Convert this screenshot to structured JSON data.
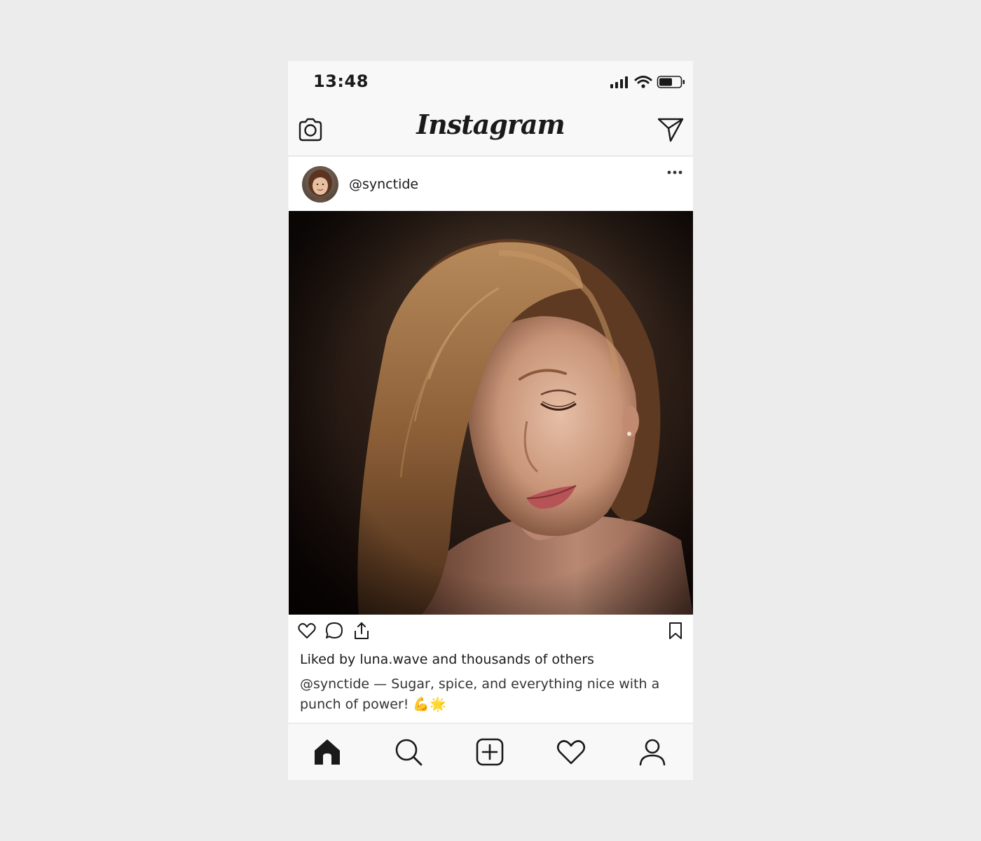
{
  "status_bar": {
    "time": "13:48",
    "icons": [
      "signal-icon",
      "wifi-icon",
      "battery-icon"
    ]
  },
  "header": {
    "logo": "Instagram",
    "left_icon": "camera-icon",
    "right_icon": "send-icon"
  },
  "post": {
    "username": "@synctide",
    "more_icon": "more-dots-icon",
    "image_description": "portrait photo",
    "actions": [
      "heart-icon",
      "comment-icon",
      "share-icon",
      "bookmark-icon"
    ],
    "likes_text": "Liked by luna.wave and thousands of others",
    "caption_user": "@synctide",
    "caption_text": " — Sugar, spice, and everything nice with a punch of power! 💪🌟"
  },
  "bottom_nav": {
    "items": [
      "home-icon",
      "search-icon",
      "add-post-icon",
      "activity-heart-icon",
      "profile-icon"
    ]
  },
  "colors": {
    "background": "#ececec",
    "app_bg": "#f8f8f8",
    "text": "#1a1a1a"
  }
}
